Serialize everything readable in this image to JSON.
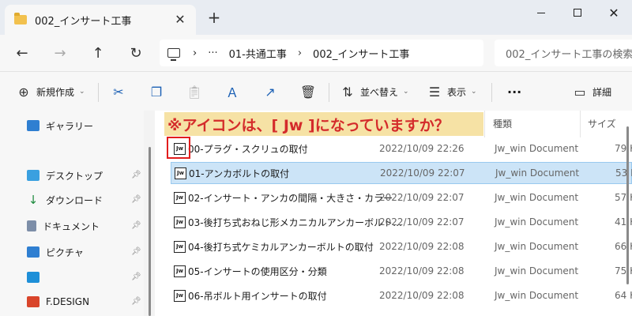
{
  "window": {
    "tab_title": "002_インサート工事",
    "new_tab_icon": "plus-icon"
  },
  "address": {
    "more": "···",
    "crumbs": [
      "01-共通工事",
      "002_インサート工事"
    ],
    "search_placeholder": "002_インサート工事の検索"
  },
  "toolbar": {
    "new_label": "新規作成",
    "sort_label": "並べ替え",
    "view_label": "表示",
    "more_label": "···",
    "details_label": "詳細"
  },
  "sidebar": {
    "items": [
      {
        "label": "ギャラリー",
        "pinned": false
      },
      {
        "label": "デスクトップ",
        "pinned": true
      },
      {
        "label": "ダウンロード",
        "pinned": true
      },
      {
        "label": "ドキュメント",
        "pinned": true
      },
      {
        "label": "ピクチャ",
        "pinned": true
      },
      {
        "label": "",
        "pinned": true
      },
      {
        "label": "F.DESIGN",
        "pinned": true
      }
    ]
  },
  "columns": {
    "type": "種類",
    "size": "サイズ"
  },
  "annotation": "※アイコンは、[ Jw ]になっていますか？",
  "file_icon_text": "Jw",
  "files": [
    {
      "name": "00-プラグ・スクリュの取付",
      "date": "2022/10/09 22:26",
      "type": "Jw_win Document",
      "size": "79 K"
    },
    {
      "name": "01-アンカボルトの取付",
      "date": "2022/10/09 22:07",
      "type": "Jw_win Document",
      "size": "53 K",
      "selected": true
    },
    {
      "name": "02-インサート・アンカの間隔・大きさ・カラー",
      "date": "2022/10/09 22:07",
      "type": "Jw_win Document",
      "size": "57 K"
    },
    {
      "name": "03-後打ち式おねじ形メカニカルアンカーボルト…",
      "date": "2022/10/09 22:07",
      "type": "Jw_win Document",
      "size": "41 K"
    },
    {
      "name": "04-後打ち式ケミカルアンカーボルトの取付",
      "date": "2022/10/09 22:08",
      "type": "Jw_win Document",
      "size": "66 K"
    },
    {
      "name": "05-インサートの使用区分・分類",
      "date": "2022/10/09 22:08",
      "type": "Jw_win Document",
      "size": "75 K"
    },
    {
      "name": "06-吊ボルト用インサートの取付",
      "date": "2022/10/09 22:08",
      "type": "Jw_win Document",
      "size": "64 K"
    }
  ]
}
